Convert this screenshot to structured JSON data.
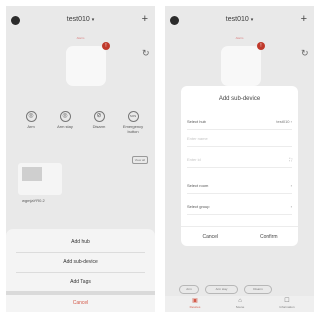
{
  "left_screen": {
    "title": "test010",
    "caret": "▾",
    "status_label": "Alarm",
    "modes": [
      {
        "label": "Arm",
        "icon": "arm-icon",
        "glyph": "◎"
      },
      {
        "label": "Arm stay",
        "icon": "arm-stay-icon",
        "glyph": "◎"
      },
      {
        "label": "Disarm",
        "icon": "disarm-icon",
        "glyph": "⊘"
      },
      {
        "label": "Emergency button",
        "icon": "emergency-icon",
        "glyph": "SOS"
      }
    ],
    "see_all": "View all",
    "device_name": "wgmjaYR0.2",
    "sheet": {
      "items": [
        "Add hub",
        "Add sub-device",
        "Add Tags"
      ],
      "cancel": "Cancel"
    }
  },
  "right_screen": {
    "title": "test010",
    "caret": "▾",
    "status_label": "Alarm",
    "dialog": {
      "title": "Add sub-device",
      "select_hub_label": "Select hub",
      "select_hub_value": "test010",
      "name_placeholder": "Enter name",
      "id_placeholder": "Enter id",
      "select_room_label": "Select room",
      "select_group_label": "Select group",
      "cancel": "Cancel",
      "confirm": "Confirm"
    },
    "pills": [
      "Arm",
      "Arm stay",
      "Disarm"
    ],
    "nav": [
      {
        "label": "Devices",
        "icon": "devices-icon",
        "glyph": "▣"
      },
      {
        "label": "Scene",
        "icon": "scene-icon",
        "glyph": "⌂"
      },
      {
        "label": "Information",
        "icon": "information-icon",
        "glyph": "☐"
      }
    ]
  },
  "colors": {
    "accent": "#d35a4a",
    "alarm": "#c0392b",
    "overlay": "#e9e9e9"
  }
}
